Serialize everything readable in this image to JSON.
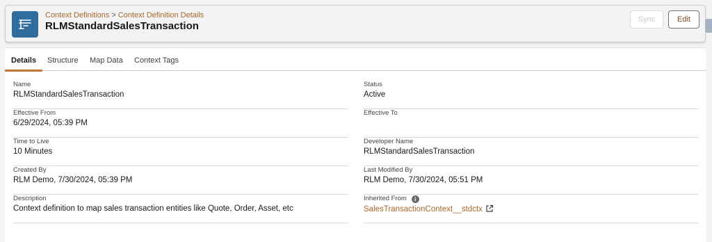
{
  "header": {
    "breadcrumb": [
      "Context Definitions",
      "Context Definition Details"
    ],
    "breadcrumb_separator": ">",
    "title": "RLMStandardSalesTransaction",
    "icon": "context-definition-icon",
    "accent_color": "#2e6d9e",
    "buttons": {
      "sync": "Sync",
      "edit": "Edit"
    }
  },
  "tabs": [
    {
      "label": "Details",
      "active": true
    },
    {
      "label": "Structure",
      "active": false
    },
    {
      "label": "Map Data",
      "active": false
    },
    {
      "label": "Context Tags",
      "active": false
    }
  ],
  "fields": {
    "name": {
      "label": "Name",
      "value": "RLMStandardSalesTransaction"
    },
    "status": {
      "label": "Status",
      "value": "Active"
    },
    "effective_from": {
      "label": "Effective From",
      "value": "6/29/2024, 05:39 PM"
    },
    "effective_to": {
      "label": "Effective To",
      "value": ""
    },
    "time_to_live": {
      "label": "Time to Live",
      "value": "10 Minutes"
    },
    "developer_name": {
      "label": "Developer Name",
      "value": "RLMStandardSalesTransaction"
    },
    "created_by": {
      "label": "Created By",
      "value": "RLM Demo, 7/30/2024, 05:39 PM"
    },
    "last_modified_by": {
      "label": "Last Modified By",
      "value": "RLM Demo, 7/30/2024, 05:51 PM"
    },
    "description": {
      "label": "Description",
      "value": "Context definition to map sales transaction entities like Quote, Order, Asset, etc"
    },
    "inherited_from": {
      "label": "Inherited From",
      "value": "SalesTransactionContext__stdctx",
      "info_icon": "info-icon",
      "link_icon": "external-link-icon"
    }
  }
}
